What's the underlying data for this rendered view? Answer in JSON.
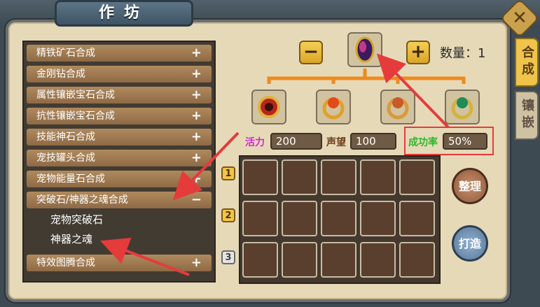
{
  "title": "作坊",
  "close_icon": "wrench-cross-icon",
  "side_tabs": [
    {
      "label": "合成",
      "active": true
    },
    {
      "label": "镶嵌",
      "active": false
    }
  ],
  "recipes": [
    {
      "label": "精铁矿石合成",
      "toggle": "+"
    },
    {
      "label": "金刚钻合成",
      "toggle": "+"
    },
    {
      "label": "属性镶嵌宝石合成",
      "toggle": "+"
    },
    {
      "label": "抗性镶嵌宝石合成",
      "toggle": "+"
    },
    {
      "label": "技能神石合成",
      "toggle": "+"
    },
    {
      "label": "宠技罐头合成",
      "toggle": "+"
    },
    {
      "label": "宠物能量石合成",
      "toggle": "+"
    },
    {
      "label": "突破石/神器之魂合成",
      "toggle": "−"
    },
    {
      "label": "特效图腾合成",
      "toggle": "+"
    }
  ],
  "sub_items": [
    "宠物突破石",
    "神器之魂"
  ],
  "product": {
    "minus": "−",
    "plus": "+",
    "quantity_label": "数量：",
    "quantity_value": "1"
  },
  "stats": {
    "vitality_label": "活力",
    "vitality_value": "200",
    "reputation_label": "声望",
    "reputation_value": "100",
    "success_label": "成功率",
    "success_value": "50%"
  },
  "grid_rows": [
    "1",
    "2",
    "3"
  ],
  "buttons": {
    "sort": "整理",
    "forge": "打造"
  },
  "colors": {
    "accent_gold": "#f2c447",
    "highlight_red": "#e53b3b",
    "success_green": "#2db82d",
    "vitality_magenta": "#d02ad0"
  }
}
